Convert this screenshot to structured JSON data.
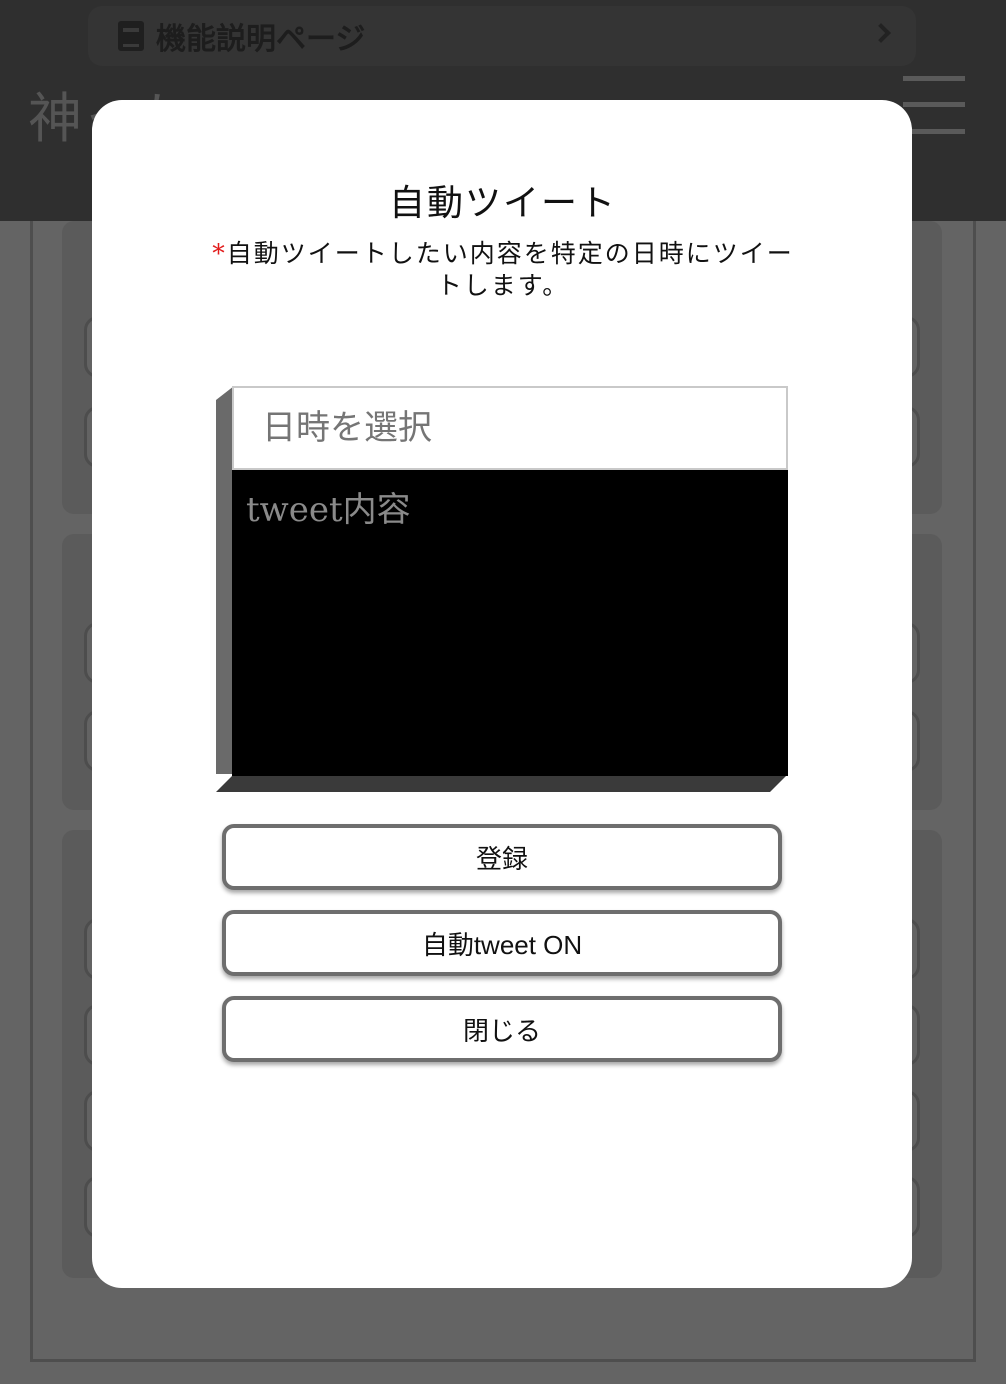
{
  "background": {
    "guide_link_label": "機能説明ページ",
    "site_title": "神ったー"
  },
  "modal": {
    "title": "自動ツイート",
    "required_mark": "*",
    "description": "自動ツイートしたい内容を特定の日時にツイートします。",
    "date_placeholder": "日時を選択",
    "tweet_placeholder": "tweet内容",
    "buttons": {
      "register": "登録",
      "auto_tweet_toggle": "自動tweet ON",
      "close": "閉じる"
    }
  },
  "colors": {
    "overlay_bg": "#646464",
    "required_mark": "#e21b1b",
    "tweet_area_bg": "#000000"
  }
}
